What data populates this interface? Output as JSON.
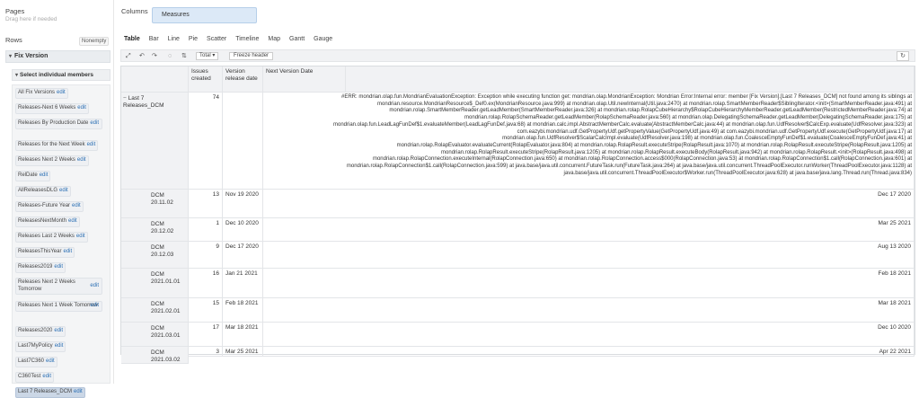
{
  "left_panel": {
    "pages_title": "Pages",
    "pages_hint": "Drag here if needed",
    "rows_title": "Rows",
    "nonempty_label": "Nonempty",
    "dimension_label": "Fix Version",
    "select_members_label": "Select individual members",
    "members": [
      {
        "label": "All Fix Versions",
        "edit": "edit"
      },
      {
        "label": "Releases-Next 6 Weeks",
        "edit": "edit"
      },
      {
        "label": "Releases By Production Date",
        "edit": "edit"
      },
      {
        "label": "Releases for the Next Week",
        "edit": "edit"
      },
      {
        "label": "Releases Next 2 Weeks",
        "edit": "edit"
      },
      {
        "label": "RelDate",
        "edit": "edit"
      },
      {
        "label": "AllReleasesDLG",
        "edit": "edit"
      },
      {
        "label": "Releases-Future Year",
        "edit": "edit"
      },
      {
        "label": "ReleasesNextMonth",
        "edit": "edit"
      },
      {
        "label": "Releases Last 2 Weeks",
        "edit": "edit"
      },
      {
        "label": "ReleasesThisYear",
        "edit": "edit"
      },
      {
        "label": "Releases2019",
        "edit": "edit"
      },
      {
        "label": "Releases Next 2 Weeks Tomorrow",
        "edit": "edit"
      },
      {
        "label": "Releases Next 1 Week Tomorrow",
        "edit": "edit"
      },
      {
        "label": "Releases2020",
        "edit": "edit"
      },
      {
        "label": "Last7MyPolicy",
        "edit": "edit"
      },
      {
        "label": "Last7C360",
        "edit": "edit"
      },
      {
        "label": "C360Test",
        "edit": "edit"
      },
      {
        "label": "Last 7 Releases_DCM",
        "edit": "edit"
      }
    ]
  },
  "columns": {
    "title": "Columns",
    "measures_label": "Measures"
  },
  "view_tabs": [
    "Table",
    "Bar",
    "Line",
    "Pie",
    "Scatter",
    "Timeline",
    "Map",
    "Gantt",
    "Gauge"
  ],
  "active_tab": "Table",
  "toolbar": {
    "total_label": "Total",
    "freeze_label": "Freeze header",
    "icons": [
      "expand-icon",
      "undo-icon",
      "redo-icon",
      "comment-icon",
      "sort-icon",
      "refresh-icon"
    ]
  },
  "table": {
    "headers": [
      "Issues created",
      "Version release date",
      "Next Version Date"
    ],
    "parent_row": {
      "label": "Last 7 Releases_DCM",
      "issues": "74",
      "release_date": "",
      "error_lines": [
        "#ERR: mondrian.olap.fun.MondrianEvaluationException: Exception while executing function get: mondrian.olap.MondrianException: Mondrian Error:Internal error: member [Fix Version].[Last 7 Releases_DCM] not found among its siblings at",
        "mondrian.resource.MondrianResource$_Def0.ex(MondrianResource.java:999) at mondrian.olap.Util.newInternal(Util.java:2470) at mondrian.rolap.SmartMemberReader$SiblingIterator.<init>(SmartMemberReader.java:491) at",
        "mondrian.rolap.SmartMemberReader.getLeadMember(SmartMemberReader.java:326) at mondrian.rolap.RolapCubeHierarchy$RolapCubeHierarchyMemberReader.getLeadMember(RestrictedMemberReader.java:74) at",
        "mondrian.rolap.RolapSchemaReader.getLeadMember(RolapSchemaReader.java:560) at mondrian.olap.DelegatingSchemaReader.getLeadMember(DelegatingSchemaReader.java:175) at",
        "mondrian.olap.fun.LeadLagFunDef$1.evaluateMember(LeadLagFunDef.java:68) at mondrian.calc.impl.AbstractMemberCalc.evaluate(AbstractMemberCalc.java:44) at mondrian.olap.fun.UdfResolver$CalcExp.evaluate(UdfResolver.java:323) at",
        "com.eazybi.mondrian.udf.GetPropertyUdf.getPropertyValue(GetPropertyUdf.java:49) at com.eazybi.mondrian.udf.GetPropertyUdf.execute(GetPropertyUdf.java:17) at",
        "mondrian.olap.fun.UdfResolver$ScalarCalcImpl.evaluate(UdfResolver.java:198) at mondrian.olap.fun.CoalesceEmptyFunDef$1.evaluate(CoalesceEmptyFunDef.java:41) at",
        "mondrian.rolap.RolapEvaluator.evaluateCurrent(RolapEvaluator.java:804) at mondrian.rolap.RolapResult.executeStripe(RolapResult.java:1070) at mondrian.rolap.RolapResult.executeStripe(RolapResult.java:1205) at",
        "mondrian.rolap.RolapResult.executeStripe(RolapResult.java:1205) at mondrian.rolap.RolapResult.executeBody(RolapResult.java:942) at mondrian.rolap.RolapResult.<init>(RolapResult.java:498) at",
        "mondrian.rolap.RolapConnection.executeInternal(RolapConnection.java:650) at mondrian.rolap.RolapConnection.access$000(RolapConnection.java:53) at mondrian.rolap.RolapConnection$1.call(RolapConnection.java:601) at",
        "mondrian.rolap.RolapConnection$1.call(RolapConnection.java:599) at java.base/java.util.concurrent.FutureTask.run(FutureTask.java:264) at java.base/java.util.concurrent.ThreadPoolExecutor.runWorker(ThreadPoolExecutor.java:1128) at",
        "java.base/java.util.concurrent.ThreadPoolExecutor$Worker.run(ThreadPoolExecutor.java:628) at java.base/java.lang.Thread.run(Thread.java:834)"
      ]
    },
    "rows": [
      {
        "label": "DCM 20.11.02",
        "issues": "13",
        "release_date": "Nov 19 2020",
        "next_date": "Dec 17 2020"
      },
      {
        "label": "DCM 20.12.02",
        "issues": "1",
        "release_date": "Dec 10 2020",
        "next_date": "Mar 25 2021"
      },
      {
        "label": "DCM 20.12.03",
        "issues": "9",
        "release_date": "Dec 17 2020",
        "next_date": "Aug 13 2020"
      },
      {
        "label": "DCM 2021.01.01",
        "issues": "16",
        "release_date": "Jan 21 2021",
        "next_date": "Feb 18 2021"
      },
      {
        "label": "DCM 2021.02.01",
        "issues": "15",
        "release_date": "Feb 18 2021",
        "next_date": "Mar 18 2021"
      },
      {
        "label": "DCM 2021.03.01",
        "issues": "17",
        "release_date": "Mar 18 2021",
        "next_date": "Dec 10 2020"
      },
      {
        "label": "DCM 2021.03.02",
        "issues": "3",
        "release_date": "Mar 25 2021",
        "next_date": "Apr 22 2021"
      }
    ]
  }
}
